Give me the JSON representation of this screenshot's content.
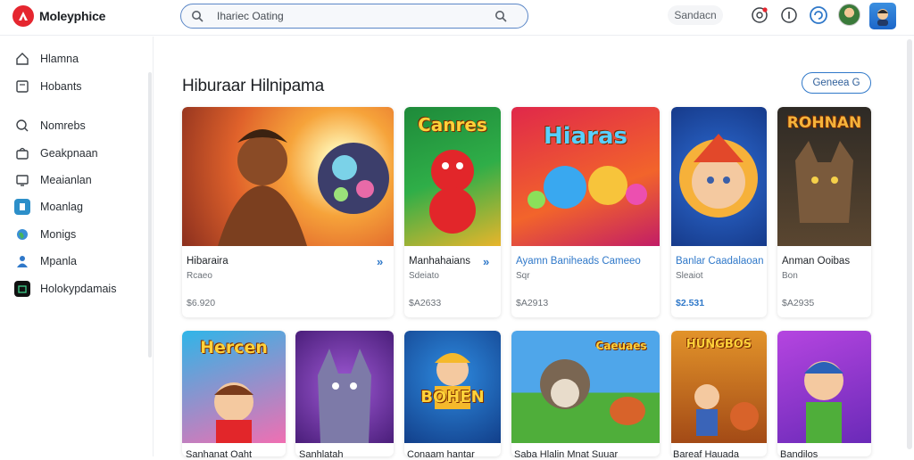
{
  "app": {
    "name": "Moleyphice"
  },
  "search": {
    "placeholder": "Ihariec Oating"
  },
  "header": {
    "text_button": "Sandacn"
  },
  "sidebar": {
    "items": [
      {
        "label": "Hlamna",
        "icon": "home-icon"
      },
      {
        "label": "Hobants",
        "icon": "book-icon"
      },
      {
        "label": "Nomrebs",
        "icon": "search-icon"
      },
      {
        "label": "Geakpnaan",
        "icon": "bag-icon"
      },
      {
        "label": "Meaianlan",
        "icon": "monitor-icon"
      },
      {
        "label": "Moanlag",
        "icon": "app-icon"
      },
      {
        "label": "Monigs",
        "icon": "globe-icon"
      },
      {
        "label": "Mpanla",
        "icon": "person-icon"
      },
      {
        "label": "Holokypdamais",
        "icon": "store-icon"
      }
    ]
  },
  "main": {
    "title": "Hiburaar Hilnipama",
    "general_button": "Geneea G",
    "cards": [
      {
        "name": "Hibaraira",
        "sub": "Rcaeo",
        "price": "$6.920",
        "thumb_title": ""
      },
      {
        "name": "Manhahaians",
        "sub": "Sdeiato",
        "price": "$A2633",
        "thumb_title": "Canres"
      },
      {
        "name": "Ayamn Baniheads Cameeo",
        "sub": "Sqr",
        "price": "$A2913",
        "thumb_title": "Hiaras"
      },
      {
        "name": "Banlar Caadalaoan",
        "sub": "Sleaiot",
        "price": "$2.531",
        "thumb_title": ""
      },
      {
        "name": "Anman Ooibas",
        "sub": "Bon",
        "price": "$A2935",
        "thumb_title": "ROHNAN"
      }
    ],
    "row2": [
      {
        "name": "Sanhanat Oaht",
        "thumb_title": "Hercen"
      },
      {
        "name": "Sanhlatah",
        "thumb_title": ""
      },
      {
        "name": "Conaam hantar",
        "thumb_title": "BOHEN"
      },
      {
        "name": "Saba Hlalin Mnat Suuar",
        "thumb_title": "Caeuaes"
      },
      {
        "name": "Bareaf Hauada",
        "thumb_title": "HUNGBOS"
      },
      {
        "name": "Bandilos",
        "thumb_title": ""
      }
    ]
  },
  "colors": {
    "accent": "#2f78c9",
    "brand": "#e5262f"
  }
}
